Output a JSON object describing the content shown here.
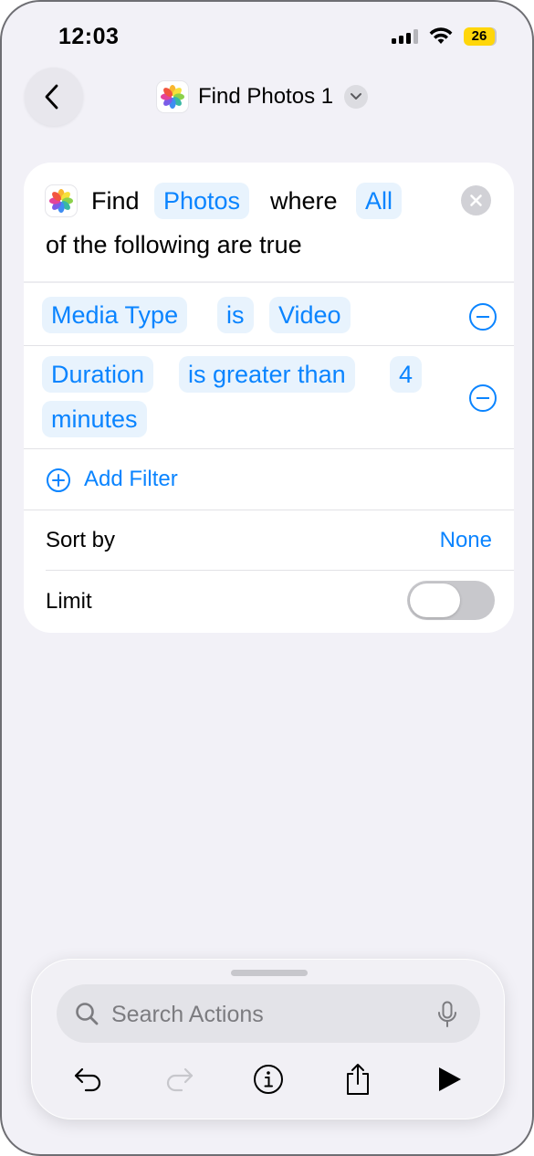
{
  "status_bar": {
    "time": "12:03",
    "battery": "26"
  },
  "nav": {
    "title": "Find Photos 1"
  },
  "action": {
    "find_word": "Find",
    "content_type": "Photos",
    "where_word": "where",
    "quantifier": "All",
    "tail_text": "of the following are true",
    "filters": [
      {
        "property": "Media Type",
        "operator": "is",
        "value": "Video"
      },
      {
        "property": "Duration",
        "operator": "is greater than",
        "value": "4",
        "unit": "minutes"
      }
    ],
    "add_filter_label": "Add Filter",
    "sort_by_label": "Sort by",
    "sort_by_value": "None",
    "limit_label": "Limit",
    "limit_enabled": false
  },
  "bottom_bar": {
    "search_placeholder": "Search Actions"
  },
  "colors": {
    "accent": "#0a84ff",
    "token_bg": "#e8f3fd",
    "background": "#f2f1f7",
    "battery": "#ffd60a"
  }
}
